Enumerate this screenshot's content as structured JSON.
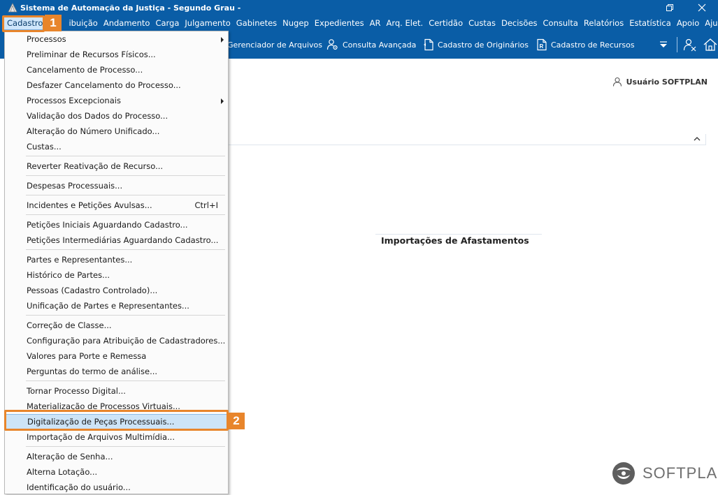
{
  "window": {
    "title": "Sistema de Automação da Justiça - Segundo Grau -"
  },
  "menubar": {
    "items": [
      "Cadastro",
      "ibuição",
      "Andamento",
      "Carga",
      "Julgamento",
      "Gabinetes",
      "Nugep",
      "Expedientes",
      "AR",
      "Arq. Elet.",
      "Certidão",
      "Custas",
      "Decisões",
      "Consulta",
      "Relatórios",
      "Estatística",
      "Apoio",
      "Ajuda"
    ]
  },
  "toolbar": {
    "gerenciador": "Gerenciador de Arquivos",
    "consulta": "Consulta Avançada",
    "originarios": "Cadastro de Originários",
    "recursos": "Cadastro de Recursos"
  },
  "user": {
    "label": "Usuário SOFTPLAN"
  },
  "panel": {
    "title": "Importações de Afastamentos"
  },
  "dropdown": {
    "items": [
      "Processos",
      "Preliminar de Recursos Físicos...",
      "Cancelamento de Processo...",
      "Desfazer Cancelamento do Processo...",
      "Processos Excepcionais",
      "Validação dos Dados do Processo...",
      "Alteração do Número Unificado...",
      "Custas...",
      "Reverter Reativação de Recurso...",
      "Despesas Processuais...",
      "Incidentes e Petições Avulsas...",
      "Petições Iniciais Aguardando Cadastro...",
      "Petições Intermediárias Aguardando Cadastro...",
      "Partes e Representantes...",
      "Histórico de Partes...",
      "Pessoas (Cadastro Controlado)...",
      "Unificação de Partes e Representantes...",
      "Correção de Classe...",
      "Configuração para Atribuição de Cadastradores...",
      "Valores para Porte e Remessa",
      "Perguntas do termo de análise...",
      "Tornar Processo Digital...",
      "Materialização de Processos Virtuais...",
      "Digitalização de Peças Processuais...",
      "Importação de Arquivos Multimídia...",
      "Alteração de Senha...",
      "Alterna Lotação...",
      "Identificação do usuário..."
    ],
    "shortcut_incidentes": "Ctrl+I"
  },
  "callouts": {
    "one": "1",
    "two": "2"
  },
  "brand": {
    "name": "SOFTPLAN"
  },
  "colors": {
    "primary": "#0a5da6",
    "highlight": "#cde4f7",
    "callout": "#e8852b"
  }
}
